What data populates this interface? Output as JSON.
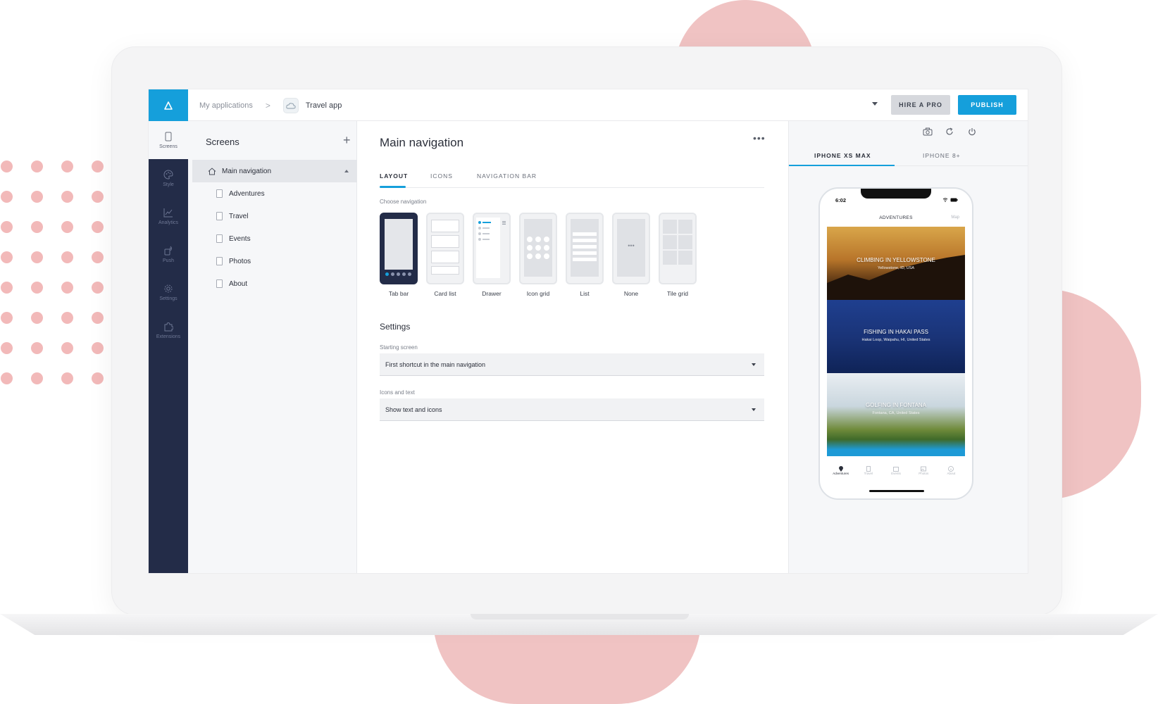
{
  "topbar": {
    "breadcrumb_root": "My applications",
    "breadcrumb_sep": ">",
    "app_name": "Travel app",
    "hire_label": "HIRE A PRO",
    "publish_label": "PUBLISH"
  },
  "rail": {
    "items": [
      {
        "label": "Screens",
        "icon": "screens-icon",
        "active": true
      },
      {
        "label": "Style",
        "icon": "palette-icon"
      },
      {
        "label": "Analytics",
        "icon": "analytics-icon"
      },
      {
        "label": "Push",
        "icon": "push-icon"
      },
      {
        "label": "Settings",
        "icon": "gear-icon"
      },
      {
        "label": "Extensions",
        "icon": "puzzle-icon"
      }
    ]
  },
  "panel": {
    "title": "Screens",
    "add": "+",
    "main_nav": "Main navigation",
    "screens": [
      "Adventures",
      "Travel",
      "Events",
      "Photos",
      "About"
    ]
  },
  "main": {
    "title": "Main navigation",
    "more": "•••",
    "tabs": [
      "LAYOUT",
      "ICONS",
      "NAVIGATION BAR"
    ],
    "choose_label": "Choose navigation",
    "nav_options": [
      "Tab bar",
      "Card list",
      "Drawer",
      "Icon grid",
      "List",
      "None",
      "Tile grid"
    ],
    "none_glyph": "•••",
    "settings_title": "Settings",
    "starting_screen_label": "Starting screen",
    "starting_screen_value": "First shortcut in the main navigation",
    "icons_text_label": "Icons and text",
    "icons_text_value": "Show text and icons"
  },
  "preview": {
    "device_tabs": [
      "IPHONE XS MAX",
      "IPHONE 8+"
    ],
    "phone": {
      "time": "6:02",
      "title": "ADVENTURES",
      "map": "Map",
      "cards": [
        {
          "title": "CLIMBING IN YELLOWSTONE",
          "subtitle": "Yellowstone, ID, USA"
        },
        {
          "title": "FISHING IN HAKAI PASS",
          "subtitle": "Hakai Loop, Waipahu, HI, United States"
        },
        {
          "title": "GOLFING IN FONTANA",
          "subtitle": "Fontana, CA, United States"
        }
      ],
      "tabbar": [
        "Adventures",
        "Travel",
        "Events",
        "Photos",
        "About"
      ]
    }
  },
  "colors": {
    "accent": "#159fdb",
    "rail": "#232c48",
    "decor": "#f0c3c3"
  }
}
